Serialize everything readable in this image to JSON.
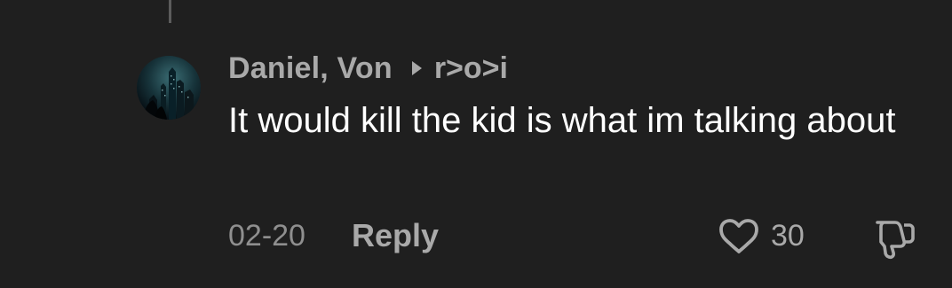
{
  "comment": {
    "author": "Daniel, Von",
    "reply_to": "r>o>i",
    "text": "It would kill the kid is what im talking about",
    "date": "02-20",
    "reply_label": "Reply",
    "like_count": "30",
    "avatar_icon": "city-night-avatar",
    "like_icon": "heart-outline-icon",
    "dislike_icon": "thumbs-down-outline-icon",
    "reply_arrow_icon": "play-arrow-icon"
  },
  "colors": {
    "background": "#1f1f1f",
    "primary_text": "#ffffff",
    "secondary_text": "#a9a9a9",
    "muted_text": "#8f8f8f"
  }
}
